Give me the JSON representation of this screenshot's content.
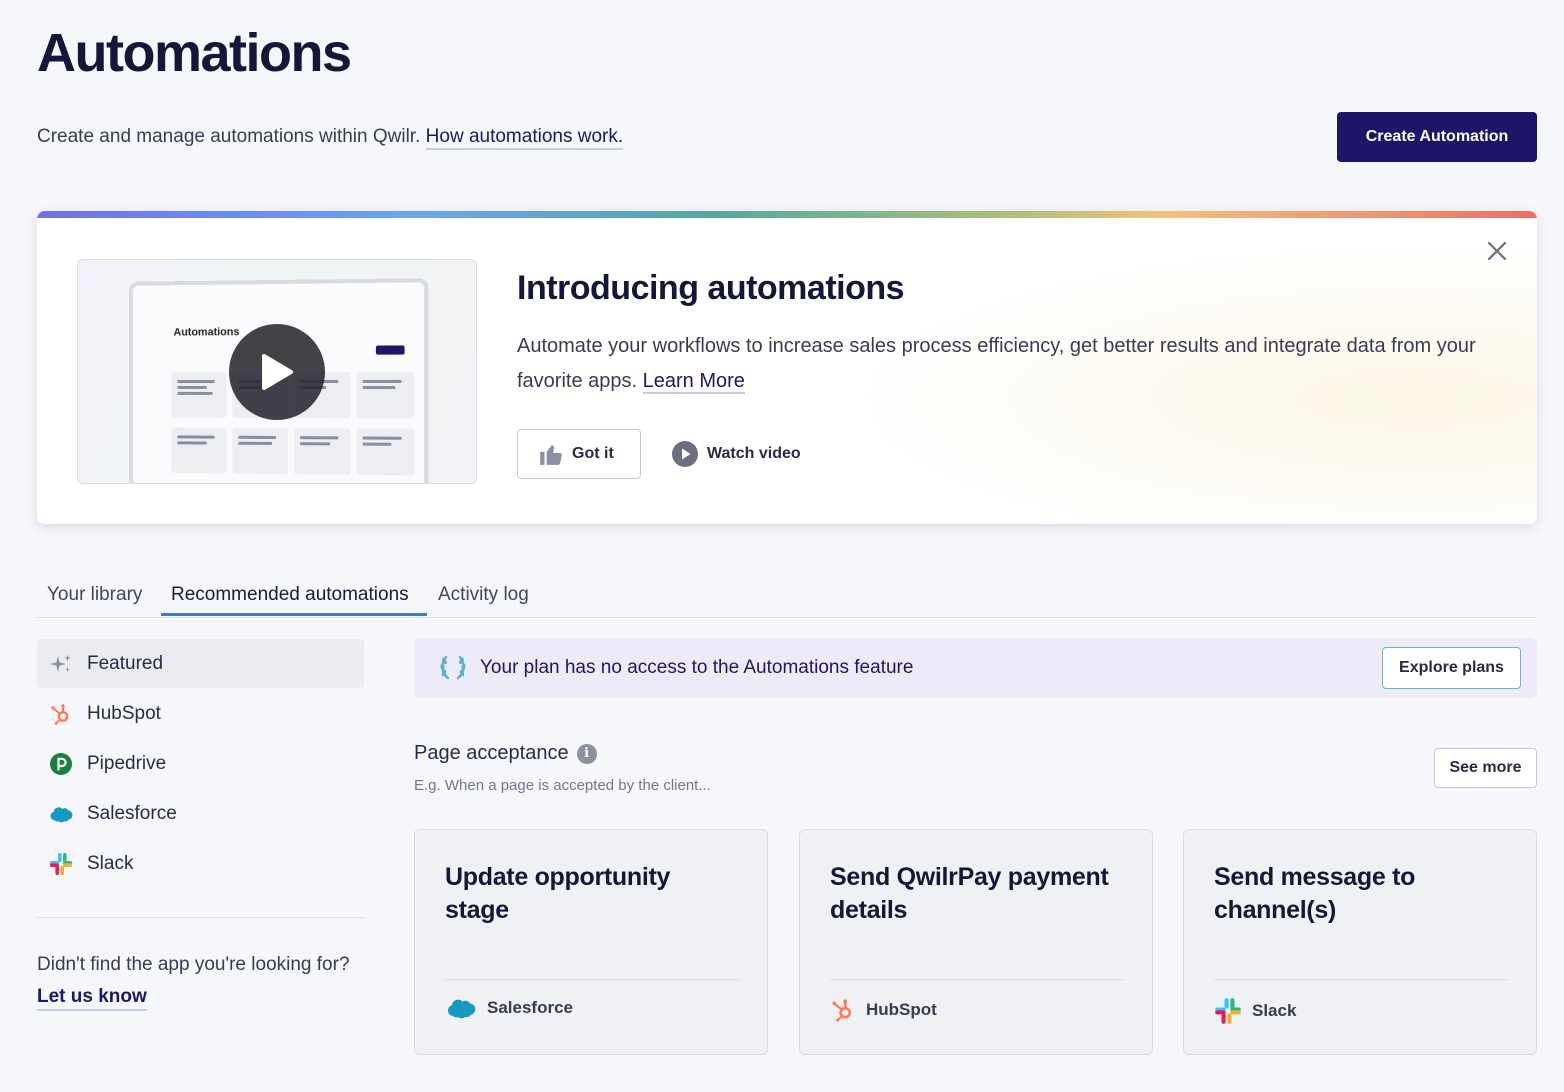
{
  "header": {
    "title": "Automations",
    "subtitle": "Create and manage automations within Qwilr.",
    "subtitle_link": "How automations work.",
    "create_button": "Create Automation"
  },
  "banner": {
    "heading": "Introducing automations",
    "text": "Automate your workflows to increase sales process efficiency, get better results and integrate data from your favorite apps.",
    "learn_more": "Learn More",
    "got_it": "Got it",
    "watch_video": "Watch video",
    "thumbnail_title": "Automations"
  },
  "tabs": [
    {
      "label": "Your library",
      "active": false
    },
    {
      "label": "Recommended automations",
      "active": true
    },
    {
      "label": "Activity log",
      "active": false
    }
  ],
  "sidebar": {
    "items": [
      {
        "label": "Featured",
        "icon": "sparkle-icon",
        "active": true
      },
      {
        "label": "HubSpot",
        "icon": "hubspot-icon",
        "active": false
      },
      {
        "label": "Pipedrive",
        "icon": "pipedrive-icon",
        "active": false
      },
      {
        "label": "Salesforce",
        "icon": "salesforce-icon",
        "active": false
      },
      {
        "label": "Slack",
        "icon": "slack-icon",
        "active": false
      }
    ],
    "help_text": "Didn't find the app you're looking for?",
    "help_link": "Let us know"
  },
  "plan_notice": {
    "text": "Your plan has no access to the Automations feature",
    "button": "Explore plans"
  },
  "section": {
    "title": "Page acceptance",
    "subtitle": "E.g. When a page is accepted by the client...",
    "see_more": "See more"
  },
  "cards": [
    {
      "title": "Update opportunity stage",
      "app": "Salesforce",
      "icon": "salesforce-icon"
    },
    {
      "title": "Send QwilrPay payment details",
      "app": "HubSpot",
      "icon": "hubspot-icon"
    },
    {
      "title": "Send message to channel(s)",
      "app": "Slack",
      "icon": "slack-icon"
    }
  ],
  "colors": {
    "primary": "#1e1468",
    "link": "#1c1767",
    "tab_accent": "#3f79d6",
    "hubspot": "#ff7a59",
    "pipedrive": "#1a7f3c",
    "salesforce": "#1798c1"
  }
}
